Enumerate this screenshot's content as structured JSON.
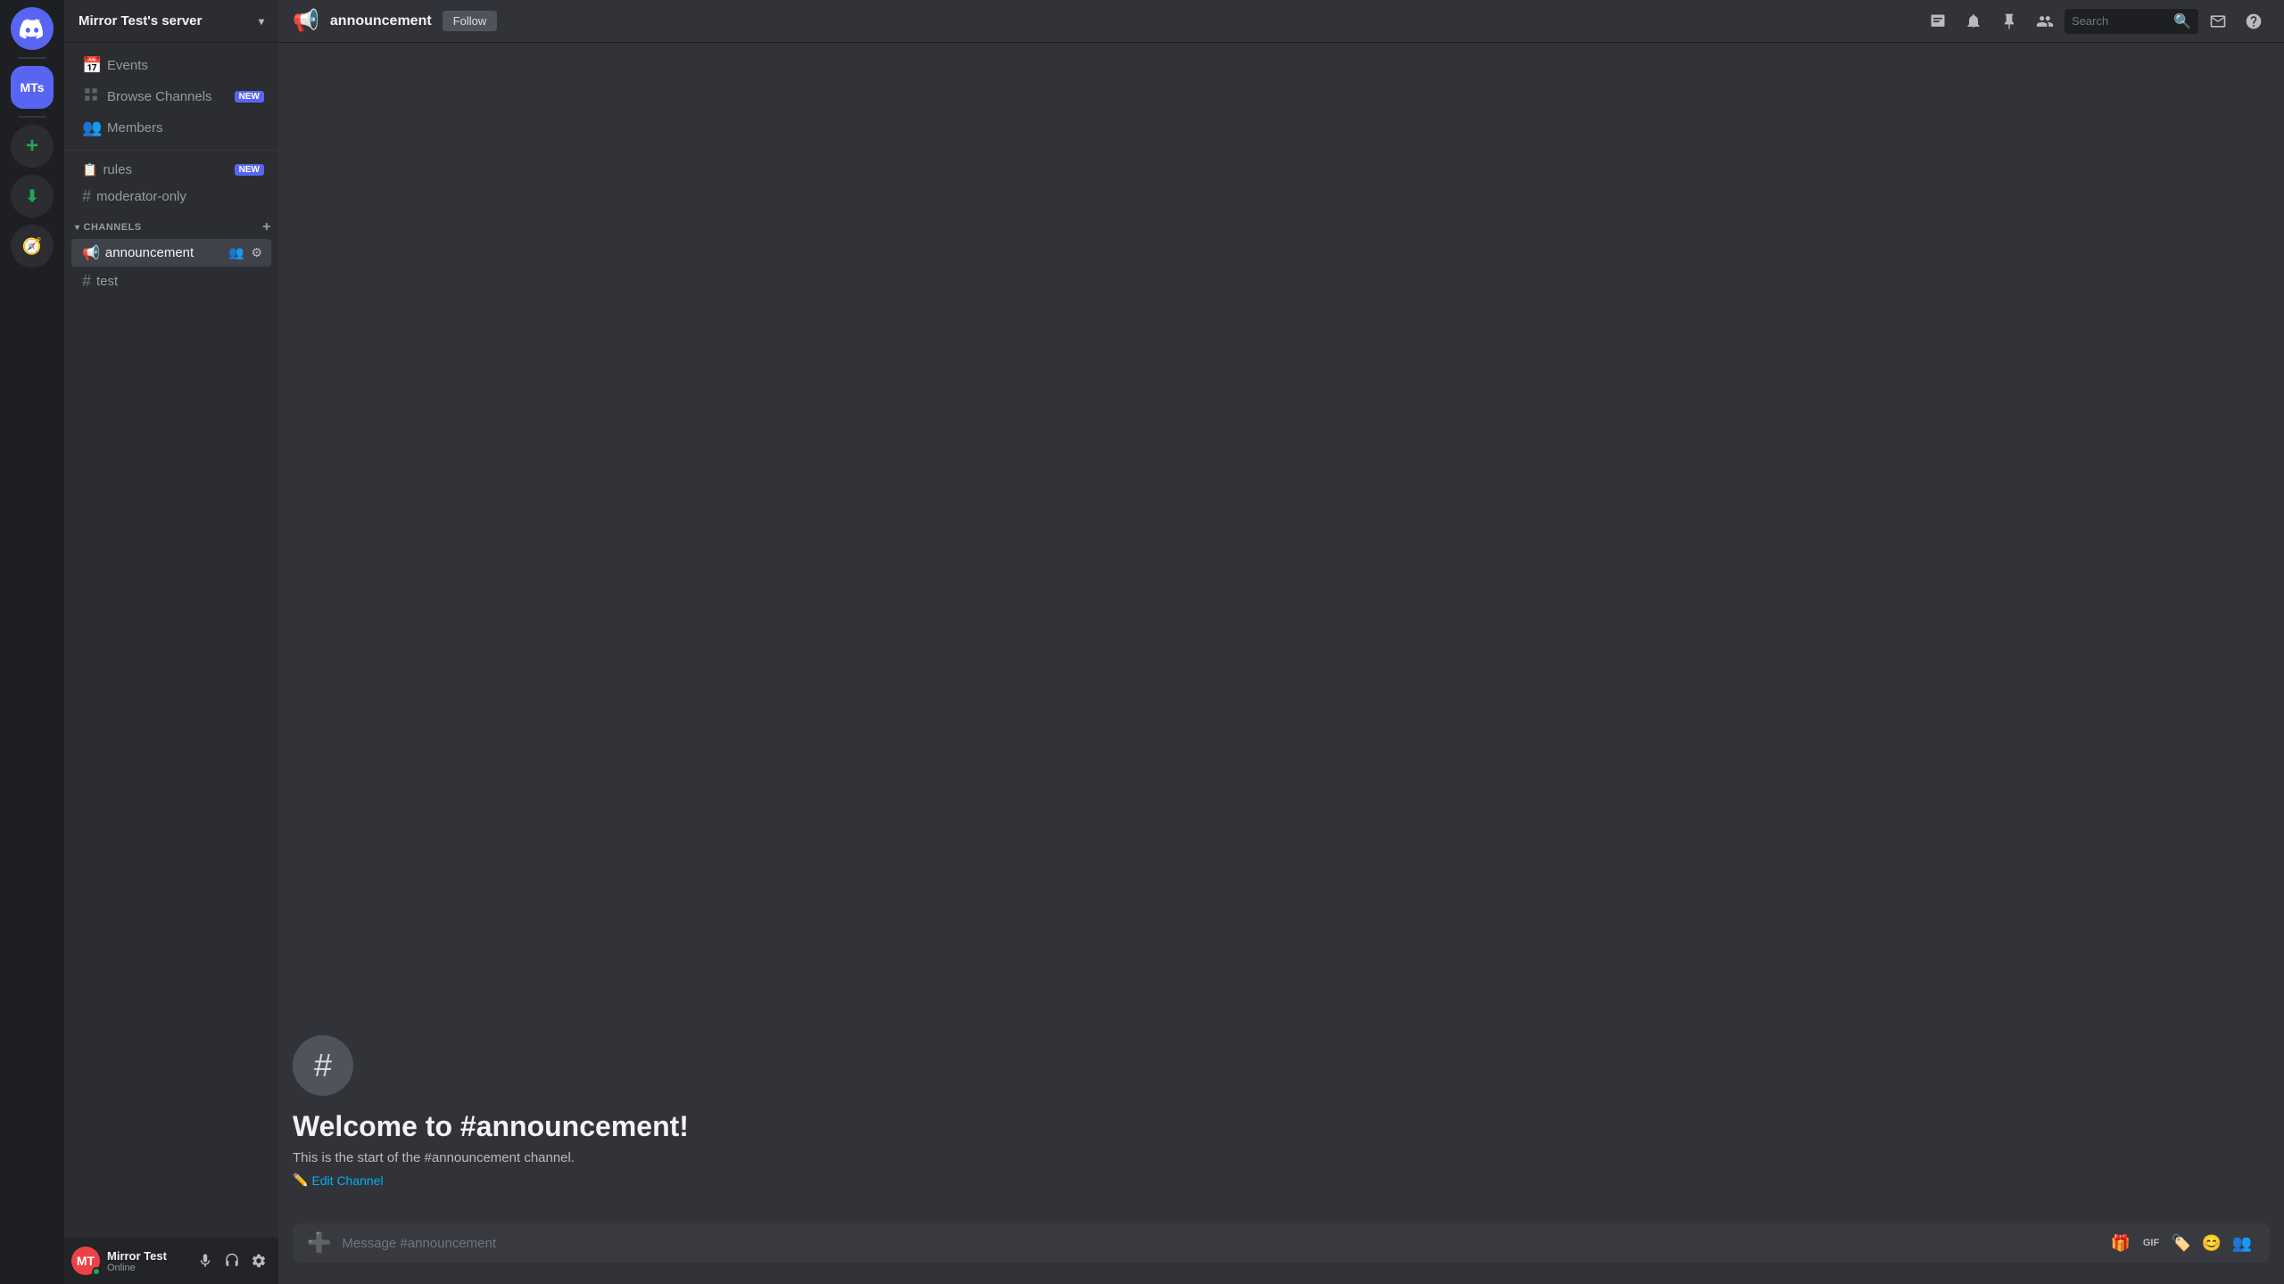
{
  "app": {
    "discord_icon": "🎮",
    "discord_logo_label": "Discord"
  },
  "server_list": {
    "discord_label": "Discord",
    "mt_label": "MTs",
    "add_label": "+",
    "download_label": "⬇",
    "discover_label": "🧭"
  },
  "sidebar": {
    "server_name": "Mirror Test's server",
    "chevron": "▾",
    "nav_items": [
      {
        "id": "events",
        "label": "Events",
        "icon": "📅"
      },
      {
        "id": "browse-channels",
        "label": "Browse Channels",
        "icon": "🔍",
        "badge": "NEW"
      },
      {
        "id": "members",
        "label": "Members",
        "icon": "👥"
      }
    ],
    "special_channels": [
      {
        "id": "rules",
        "label": "rules",
        "badge": "NEW",
        "type": "rules"
      },
      {
        "id": "moderator-only",
        "label": "moderator-only",
        "type": "text"
      }
    ],
    "category": {
      "label": "CHANNELS",
      "chevron": "▾",
      "add": "+"
    },
    "channels": [
      {
        "id": "announcement",
        "label": "announcement",
        "type": "announcement",
        "active": true
      },
      {
        "id": "test",
        "label": "test",
        "type": "text",
        "active": false
      }
    ]
  },
  "user_panel": {
    "name": "Mirror Test",
    "status": "Online",
    "avatar_initials": "MT",
    "controls": {
      "mute": "🎤",
      "deafen": "🎧",
      "settings": "⚙"
    }
  },
  "topbar": {
    "channel_icon": "📢",
    "channel_name": "announcement",
    "follow_label": "Follow",
    "search_placeholder": "Search",
    "actions": {
      "threads": "🔖",
      "notifications": "🔔",
      "pinned": "📌",
      "members": "👥",
      "help": "❓"
    }
  },
  "chat": {
    "welcome_icon": "#",
    "welcome_title": "Welcome to #announcement!",
    "welcome_desc": "This is the start of the #announcement channel.",
    "edit_channel_label": "Edit Channel",
    "message_placeholder": "Message #announcement"
  },
  "colors": {
    "brand": "#5865f2",
    "green": "#23a55a",
    "sidebar_bg": "#2b2d31",
    "dark_bg": "#1e1f22",
    "main_bg": "#313338",
    "active_channel": "#404249",
    "text_primary": "#f2f3f5",
    "text_secondary": "#b9bbbe",
    "text_muted": "#72767d"
  }
}
